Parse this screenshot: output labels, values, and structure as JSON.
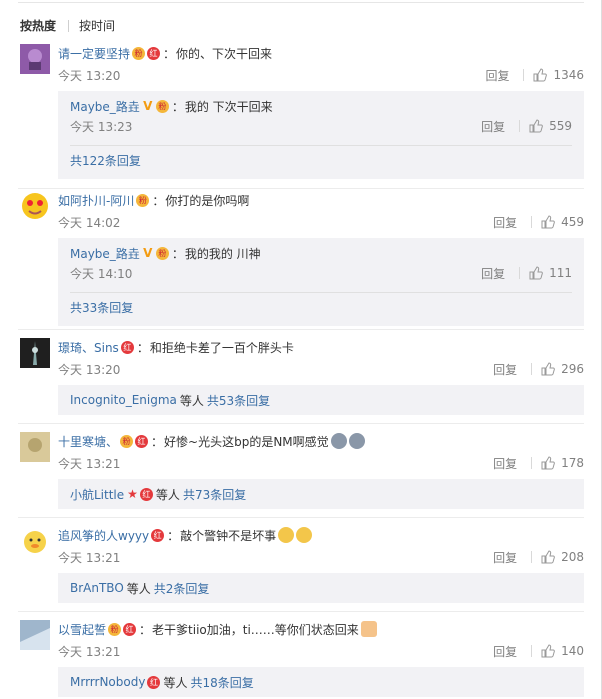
{
  "tabs": {
    "hot": "按热度",
    "time": "按时间"
  },
  "comments": [
    {
      "user": "请一定要坚持",
      "text": "你的、下次干回来",
      "time": "今天 13:20",
      "reply_label": "回复",
      "likes": "1346",
      "reply": {
        "user": "Maybe_路垚",
        "text": "我的 下次干回来",
        "time": "今天 13:23",
        "reply_label": "回复",
        "likes": "559"
      },
      "more": "共122条回复"
    },
    {
      "user": "如阿扑川-阿川",
      "text": "你打的是你吗啊",
      "time": "今天 14:02",
      "reply_label": "回复",
      "likes": "459",
      "reply": {
        "user": "Maybe_路垚",
        "text": "我的我的 川神",
        "time": "今天 14:10",
        "reply_label": "回复",
        "likes": "111"
      },
      "more": "共33条回复"
    },
    {
      "user": "璟琦、Sins",
      "text": "和拒绝卡差了一百个胖头卡",
      "time": "今天 13:20",
      "reply_label": "回复",
      "likes": "296",
      "more_user": "Incognito_Enigma",
      "more_mid": "等人",
      "more": "共53条回复"
    },
    {
      "user": "十里寒塘、",
      "text": "好惨~光头这bp的是NM啊感觉",
      "time": "今天 13:21",
      "reply_label": "回复",
      "likes": "178",
      "more_user": "小航Little",
      "more_mid": "等人",
      "more": "共73条回复"
    },
    {
      "user": "追风筝的人wyyy",
      "text": "敲个警钟不是坏事",
      "time": "今天 13:21",
      "reply_label": "回复",
      "likes": "208",
      "more_user": "BrAnTBO",
      "more_mid": "等人",
      "more": "共2条回复"
    },
    {
      "user": "以雪起誓",
      "text": "老干爹tiio加油，ti……等你们状态回来",
      "time": "今天 13:21",
      "reply_label": "回复",
      "likes": "140",
      "more_user": "MrrrrNobody",
      "more_mid": "等人",
      "more": "共18条回复"
    }
  ],
  "colors": {
    "username": "#eb7350",
    "link": "#3a6ea5",
    "reply_bg": "#f2f2f5",
    "muted": "#808080"
  },
  "icons": [
    "thumbs-up-icon",
    "red-badge-icon",
    "fan-badge-icon",
    "verified-v-icon",
    "emoji-icon"
  ]
}
